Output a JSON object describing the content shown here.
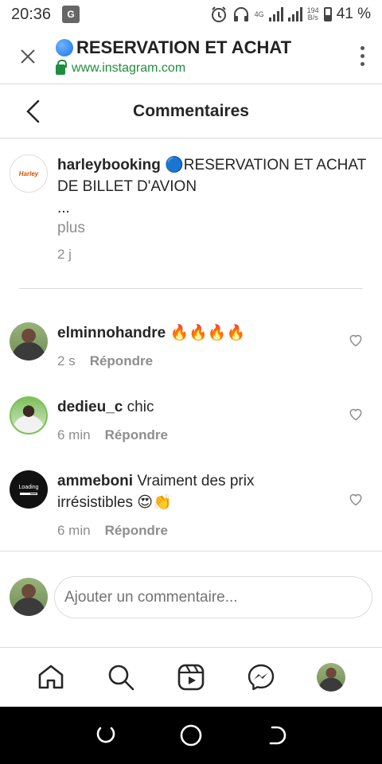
{
  "status_bar": {
    "time": "20:36",
    "translate_badge": "G",
    "network": "4G",
    "speed_value": "194",
    "speed_unit": "B/s",
    "battery": "41 %"
  },
  "browser": {
    "page_title": "RESERVATION ET ACHAT",
    "url": "www.instagram.com",
    "accent_color": "#1e8e3e"
  },
  "header": {
    "title": "Commentaires"
  },
  "caption": {
    "avatar_text": "Harley",
    "username": "harleybooking",
    "text": "🔵RESERVATION ET ACHAT DE BILLET D'AVION",
    "ellipsis": "...",
    "more": "plus",
    "age": "2 j"
  },
  "comments": [
    {
      "username": "elminnohandre",
      "text": "🔥🔥🔥🔥",
      "age": "2 s",
      "reply": "Répondre"
    },
    {
      "username": "dedieu_c",
      "text": "chic",
      "age": "6 min",
      "reply": "Répondre"
    },
    {
      "username": "ammeboni",
      "text": "Vraiment des prix irrésistibles 😍👏",
      "age": "6 min",
      "reply": "Répondre",
      "avatar_text": "Loading"
    }
  ],
  "composer": {
    "placeholder": "Ajouter un commentaire..."
  },
  "tabs": [
    "home",
    "search",
    "reels",
    "messenger",
    "profile"
  ]
}
